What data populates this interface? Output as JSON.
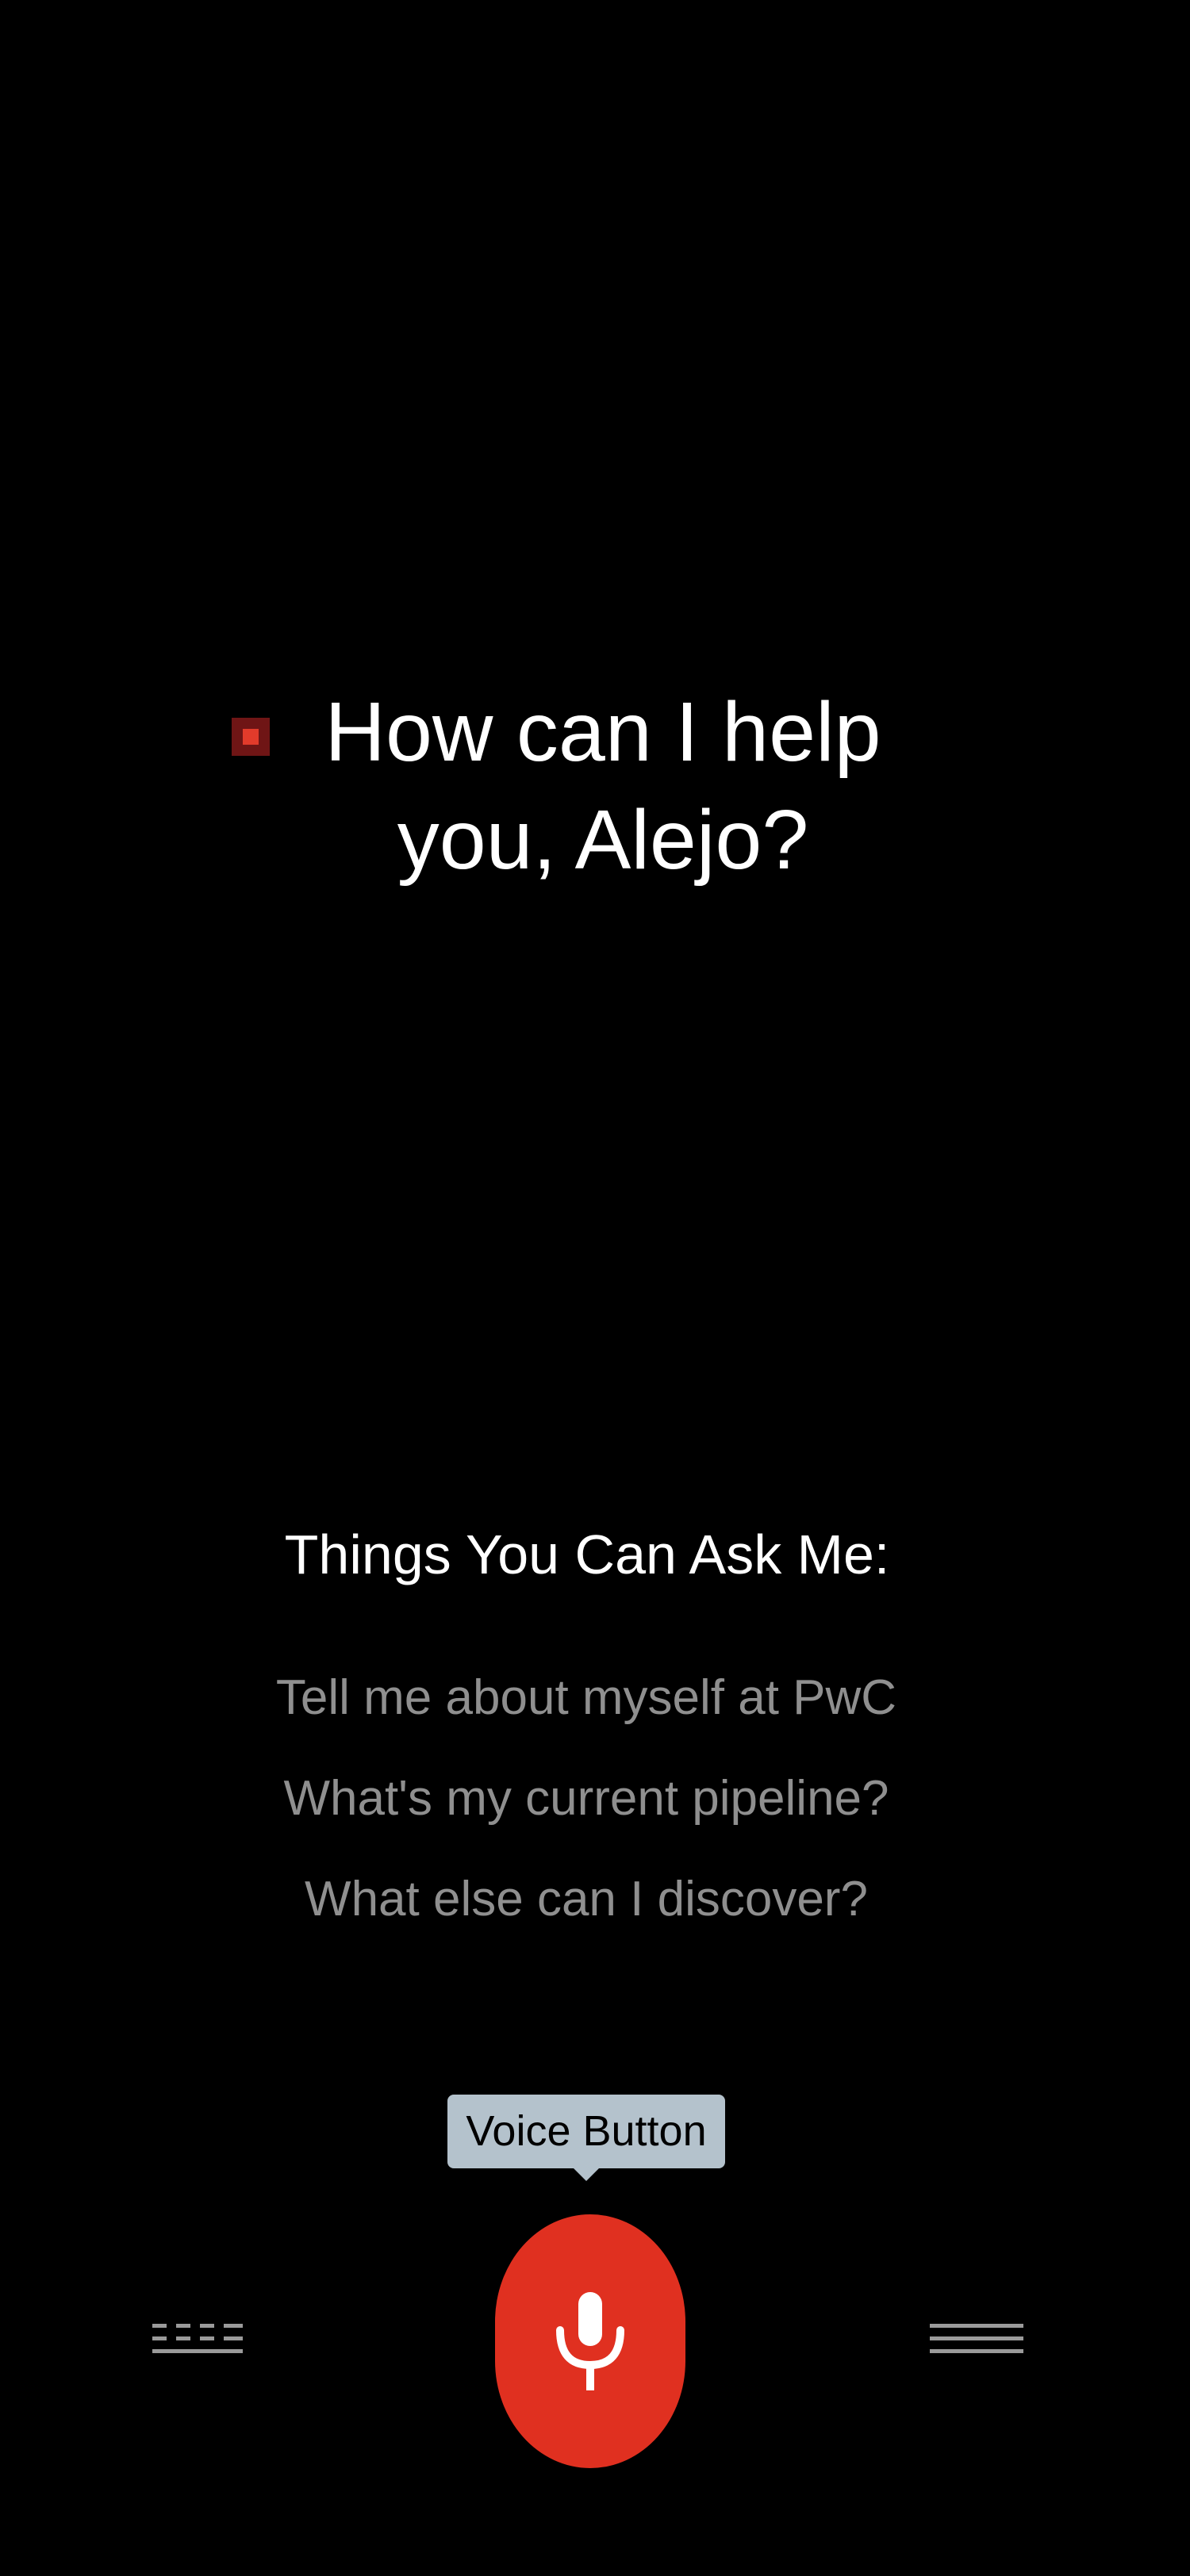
{
  "greeting": {
    "text": "How can I help you, Alejo?"
  },
  "suggestions": {
    "title": "Things You Can Ask Me:",
    "items": [
      "Tell me about myself at PwC",
      "What's my current pipeline?",
      "What else can I discover?"
    ]
  },
  "voice": {
    "tooltip": "Voice Button"
  },
  "icons": {
    "brand": "pwc-square-logo-icon",
    "keyboard": "keyboard-icon",
    "microphone": "microphone-icon",
    "menu": "menu-icon"
  },
  "colors": {
    "background": "#000000",
    "accent": "#e03020",
    "tooltip": "#b4c2cc",
    "suggestion_text": "#8f8f8f"
  }
}
